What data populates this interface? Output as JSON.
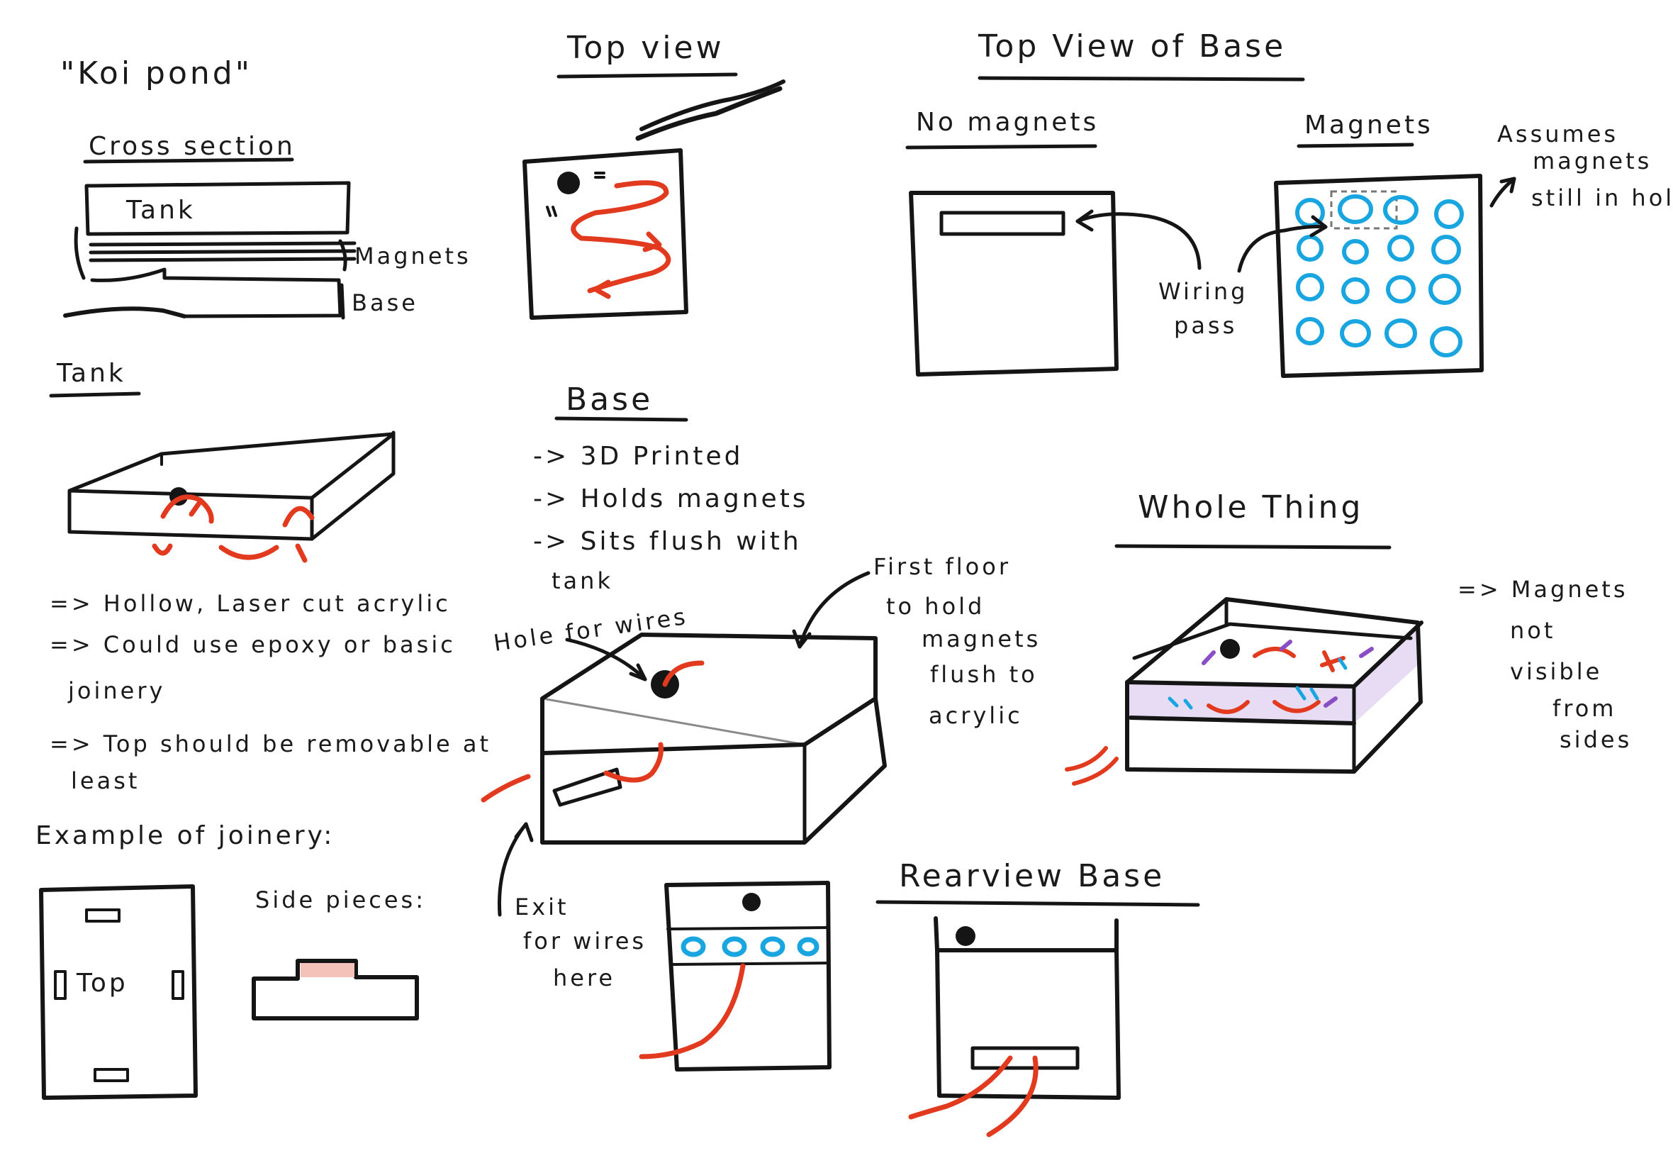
{
  "title": "\"Koi pond\"",
  "cross_section": {
    "heading": "Cross section",
    "tank": "Tank",
    "magnets": "Magnets",
    "base": "Base"
  },
  "tank_section": {
    "heading": "Tank",
    "notes": [
      "=> Hollow, Laser cut acrylic",
      "=> Could use epoxy or basic",
      "joinery",
      "=> Top should be removable at",
      "least"
    ]
  },
  "joinery": {
    "heading": "Example of joinery:",
    "top_label": "Top",
    "side_label": "Side pieces:"
  },
  "top_view": {
    "heading": "Top view"
  },
  "base_section": {
    "heading": "Base",
    "notes": [
      "-> 3D Printed",
      "-> Holds magnets",
      "-> Sits flush with",
      "tank"
    ],
    "hole_label": "Hole for wires",
    "first_floor": [
      "First floor",
      "to hold",
      "magnets",
      "flush to",
      "acrylic"
    ],
    "exit_label": [
      "Exit",
      "for wires",
      "here"
    ]
  },
  "top_view_base": {
    "heading": "Top View of Base",
    "no_magnets": "No magnets",
    "magnets": "Magnets",
    "wiring": [
      "Wiring",
      "pass"
    ],
    "assumes": [
      "Assumes",
      "magnets",
      "still in holder"
    ]
  },
  "whole_thing": {
    "heading": "Whole Thing",
    "notes": [
      "=> Magnets",
      "not",
      "visible",
      "from",
      "sides"
    ]
  },
  "rearview": {
    "heading": "Rearview Base"
  },
  "colors": {
    "ink": "#151515",
    "water_flow": "#e23a1f",
    "magnet": "#19a6e0",
    "base_fill": "#8a4fc4"
  }
}
